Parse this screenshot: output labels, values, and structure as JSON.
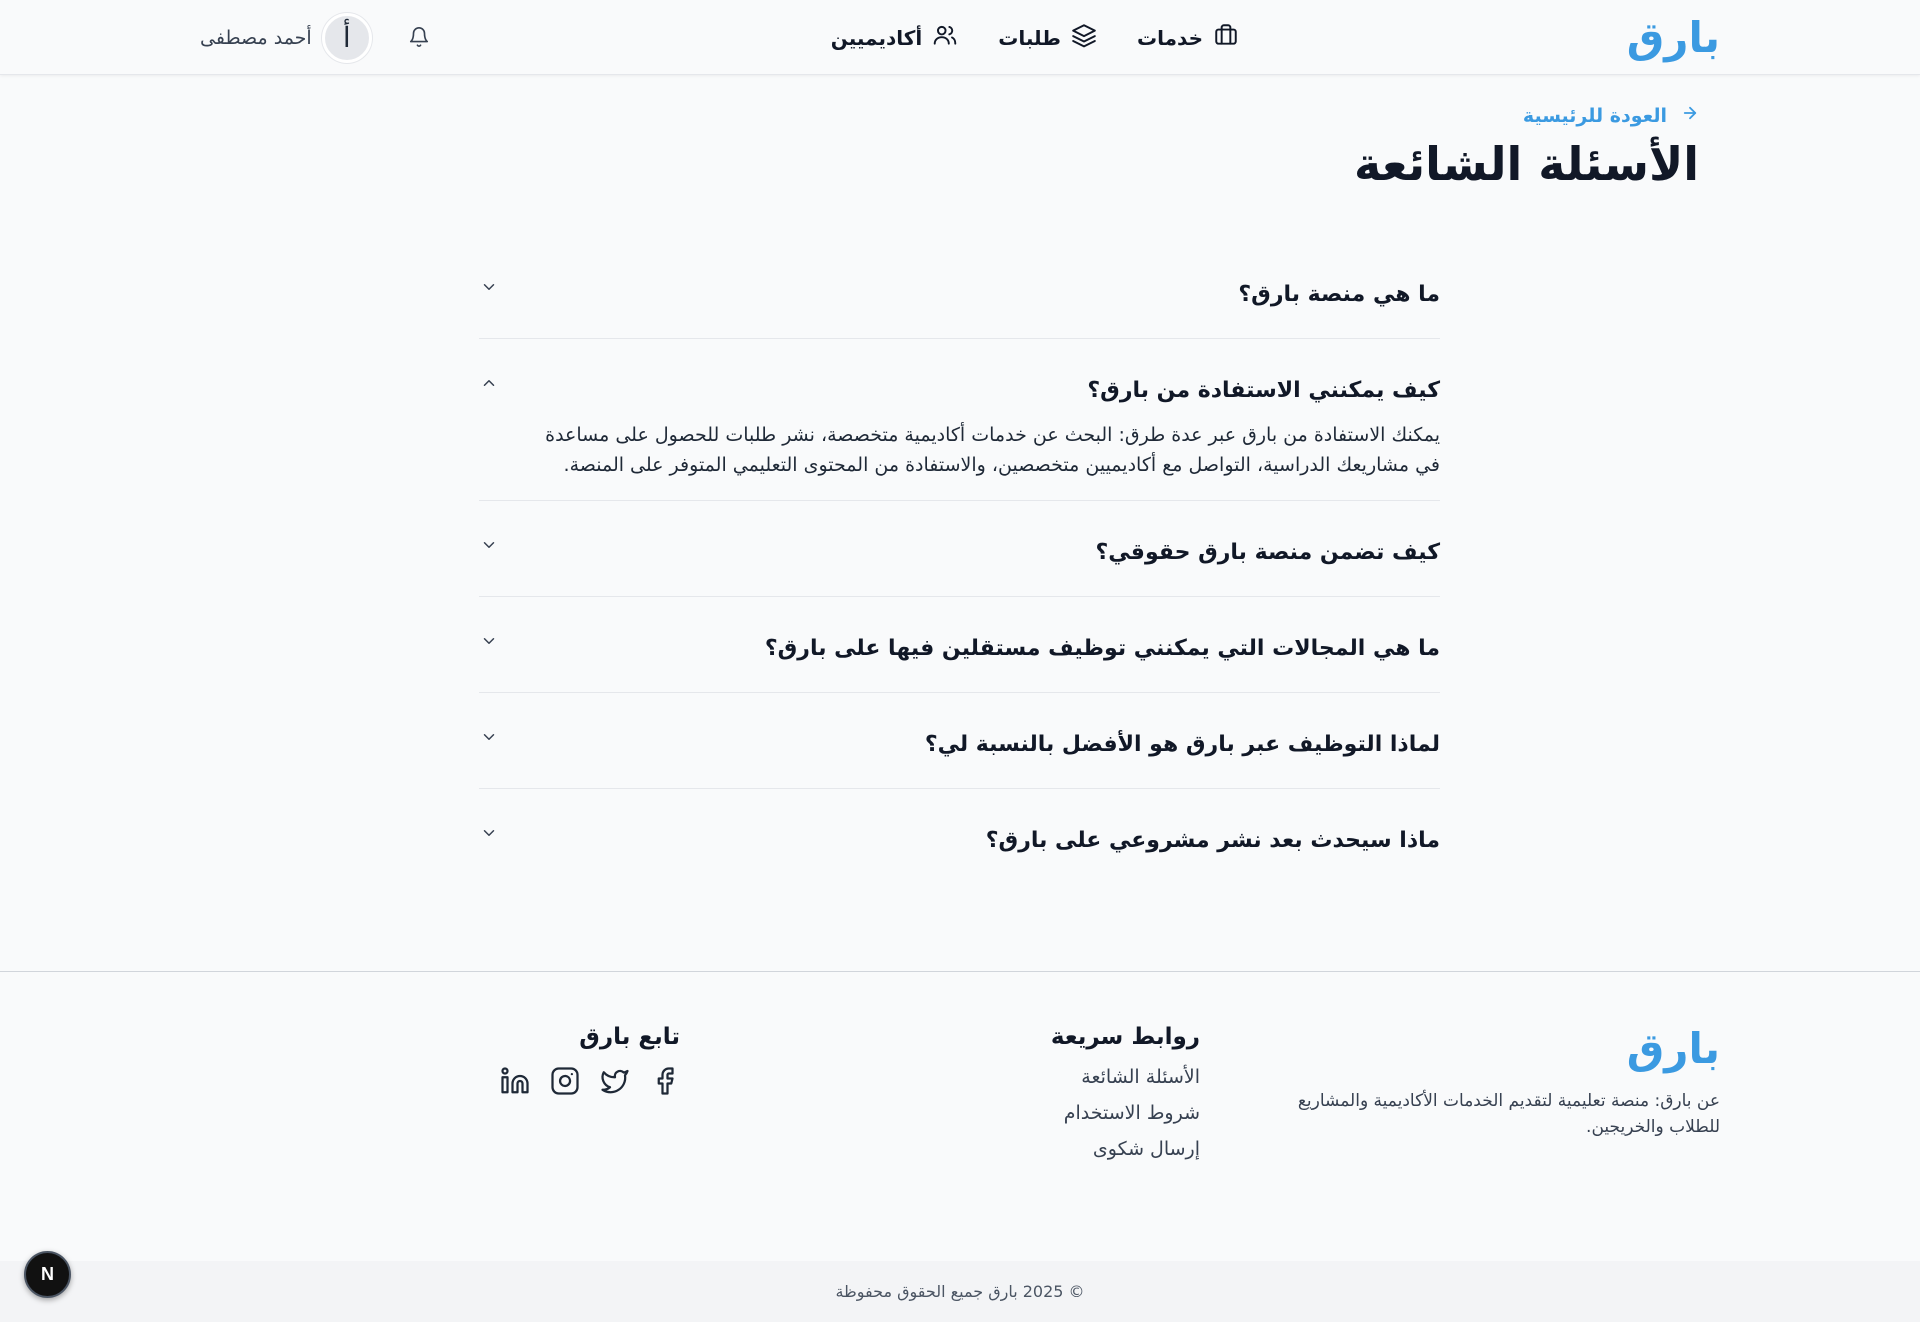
{
  "header": {
    "brand": "بارق",
    "nav": [
      {
        "label": "خدمات",
        "icon": "briefcase-icon"
      },
      {
        "label": "طلبات",
        "icon": "layers-icon"
      },
      {
        "label": "أكاديميين",
        "icon": "users-icon"
      }
    ],
    "user_name": "أحمد مصطفى",
    "avatar_letter": "أ",
    "notification_icon": "bell-icon"
  },
  "page": {
    "back_label": "العودة للرئيسية",
    "title": "الأسئلة الشائعة"
  },
  "faq": [
    {
      "question": "ما هي منصة بارق؟",
      "expanded": false
    },
    {
      "question": "كيف يمكنني الاستفادة من بارق؟",
      "expanded": true,
      "answer": "يمكنك الاستفادة من بارق عبر عدة طرق: البحث عن خدمات أكاديمية متخصصة، نشر طلبات للحصول على مساعدة في مشاريعك الدراسية، التواصل مع أكاديميين متخصصين، والاستفادة من المحتوى التعليمي المتوفر على المنصة."
    },
    {
      "question": "كيف تضمن منصة بارق حقوقي؟",
      "expanded": false
    },
    {
      "question": "ما هي المجالات التي يمكنني توظيف مستقلين فيها على بارق؟",
      "expanded": false
    },
    {
      "question": "لماذا التوظيف عبر بارق هو الأفضل بالنسبة لي؟",
      "expanded": false
    },
    {
      "question": "ماذا سيحدث بعد نشر مشروعي على بارق؟",
      "expanded": false
    }
  ],
  "footer": {
    "brand": "بارق",
    "about": "عن بارق: منصة تعليمية لتقديم الخدمات الأكاديمية والمشاريع للطلاب والخريجين.",
    "links_heading": "روابط سريعة",
    "links": [
      "الأسئلة الشائعة",
      "شروط الاستخدام",
      "إرسال شكوى"
    ],
    "follow_heading": "تابع بارق",
    "social": [
      "facebook-icon",
      "twitter-icon",
      "instagram-icon",
      "linkedin-icon"
    ],
    "copyright": "© 2025 بارق جميع الحقوق محفوظة"
  },
  "dev_badge": "N",
  "colors": {
    "accent": "#3b9ae1",
    "text": "#111827",
    "background": "#f9fafb"
  }
}
